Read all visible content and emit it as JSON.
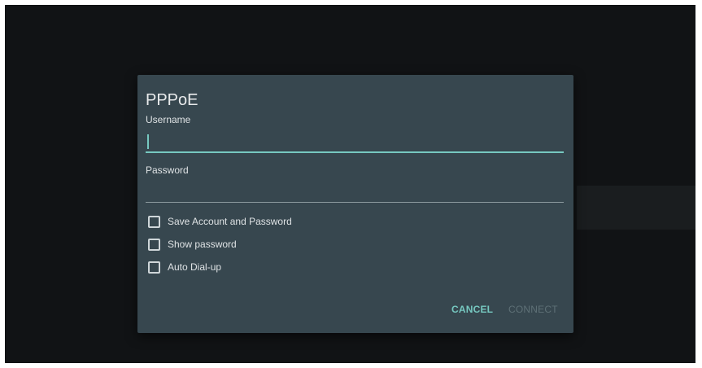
{
  "dialog": {
    "title": "PPPoE",
    "username": {
      "label": "Username",
      "value": ""
    },
    "password": {
      "label": "Password",
      "value": ""
    },
    "options": [
      {
        "label": "Save Account and Password",
        "checked": false
      },
      {
        "label": "Show password",
        "checked": false
      },
      {
        "label": "Auto Dial-up",
        "checked": false
      }
    ],
    "buttons": {
      "cancel": "CANCEL",
      "connect": "CONNECT",
      "connect_enabled": false
    }
  },
  "colors": {
    "screen_bg": "#111315",
    "dialog_bg": "#37474f",
    "accent": "#76c8c0",
    "disabled": "#5e7076"
  }
}
